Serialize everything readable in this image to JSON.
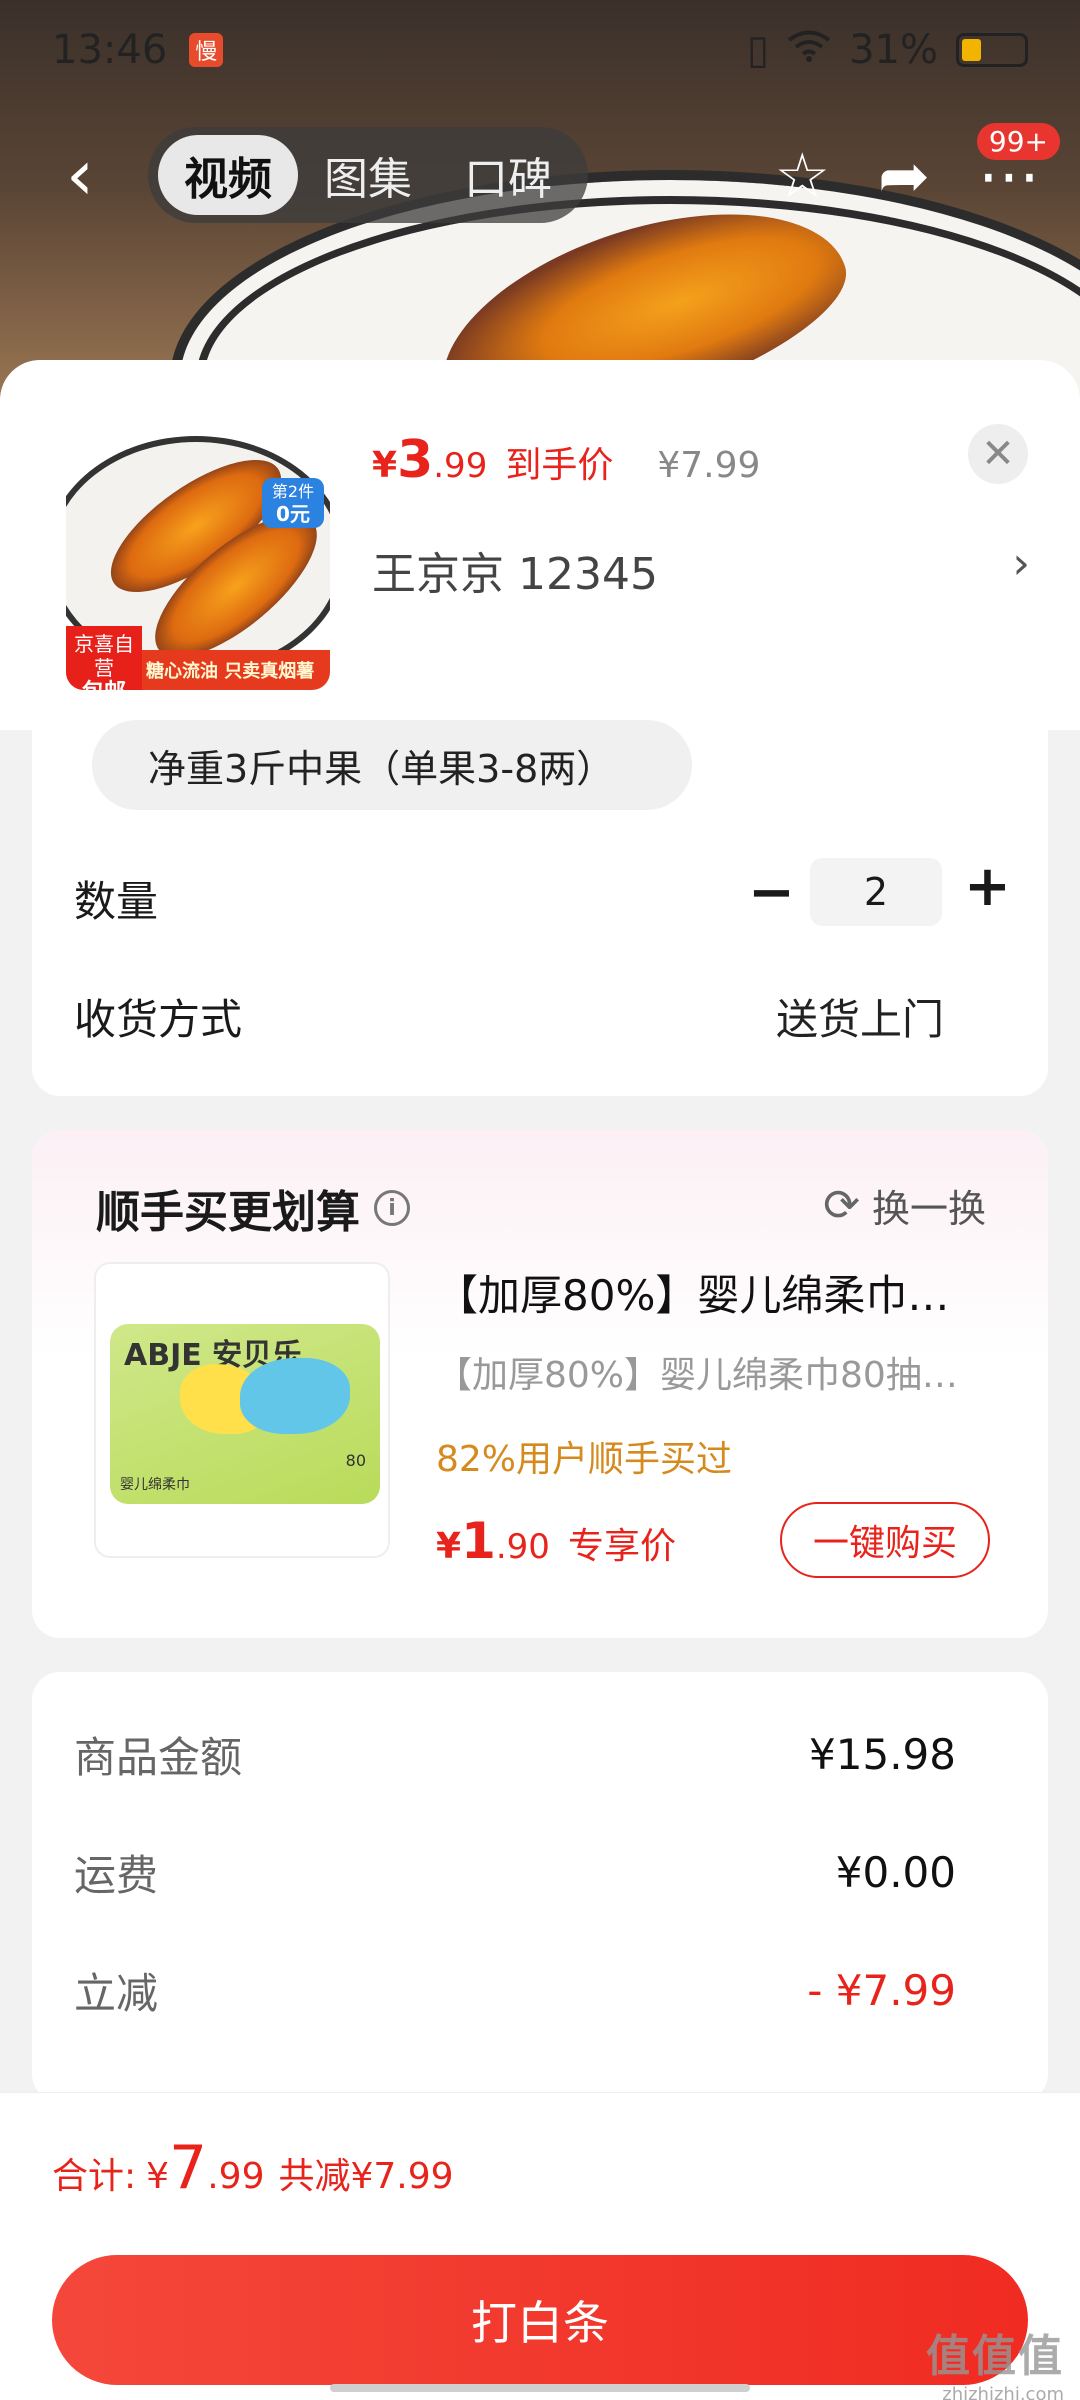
{
  "status_bar": {
    "time": "13:46",
    "app_badge": "慢",
    "wifi_icon": "wifi-icon",
    "battery_text": "31%",
    "battery_level": 0.31
  },
  "nav": {
    "back_icon": "back-icon",
    "tabs": [
      {
        "label": "视频",
        "active": true
      },
      {
        "label": "图集",
        "active": false
      },
      {
        "label": "口碑",
        "active": false
      }
    ],
    "favorite_icon": "star-icon",
    "share_icon": "share-icon",
    "more_icon": "more-icon",
    "more_badge": "99+"
  },
  "product": {
    "price_currency": "¥",
    "price_int": "3",
    "price_dec": ".99",
    "price_label": "到手价",
    "original_price": "¥7.99",
    "spec_text": "王京京  12345",
    "close_icon": "close-icon",
    "image_tag_line1": "第2件",
    "image_tag_line2": "0元",
    "image_badge_line1": "京喜自营",
    "image_badge_line2": "包邮",
    "image_banner": "糖心流油 只卖真烟薯"
  },
  "spec_option": "净重3斤中果（单果3-8两）",
  "quantity": {
    "label": "数量",
    "value": "2",
    "minus": "−",
    "plus": "+"
  },
  "delivery": {
    "label": "收货方式",
    "value": "送货上门"
  },
  "recommend": {
    "title": "顺手买更划算",
    "info_icon": "i",
    "refresh_label": "换一换",
    "item_name": "【加厚80%】婴儿绵柔巾…",
    "item_sub": "【加厚80%】婴儿绵柔巾80抽…",
    "item_stat": "82%用户顺手买过",
    "item_price_currency": "¥",
    "item_price_int": "1",
    "item_price_dec": ".90",
    "item_price_label": "专享价",
    "buy_button": "一键购买",
    "image_brand": "ABJE 安贝乐",
    "image_count": "80",
    "image_label": "婴儿绵柔巾"
  },
  "summary": {
    "rows": [
      {
        "label": "商品金额",
        "value": "¥15.98"
      },
      {
        "label": "运费",
        "value": "¥0.00"
      },
      {
        "label": "立减",
        "value": "- ¥7.99"
      }
    ]
  },
  "footer": {
    "total_label": "合计:",
    "total_currency": "¥",
    "total_int": "7",
    "total_dec": ".99",
    "total_save": "共减¥7.99",
    "pay_button": "打白条"
  },
  "watermark": {
    "text": "值值值",
    "site": "zhizhizhi.com"
  },
  "colors": {
    "accent": "#e8231b",
    "pay_button": "#f02b22",
    "stat": "#d58a1e"
  }
}
